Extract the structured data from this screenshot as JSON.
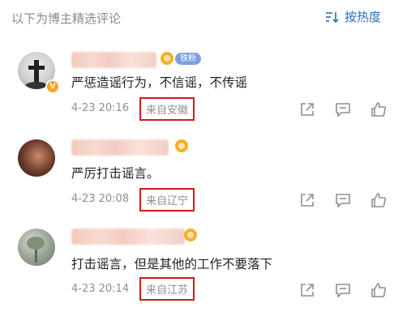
{
  "header": {
    "title": "以下为博主精选评论",
    "sort_label": "按热度"
  },
  "comments": [
    {
      "fan_badge": "铁粉",
      "text": "严惩造谣行为，不信谣，不传谣",
      "time": "4-23 20:16",
      "location": "来自安徽"
    },
    {
      "text": "严厉打击谣言。",
      "time": "4-23 20:08",
      "location": "来自辽宁"
    },
    {
      "text": "打击谣言，但是其他的工作不要落下",
      "time": "4-23 20:14",
      "location": "来自江苏"
    }
  ],
  "colors": {
    "accent": "#2d6db5",
    "highlight_box": "#d11a1a",
    "muted_text": "#8f8f8f"
  }
}
